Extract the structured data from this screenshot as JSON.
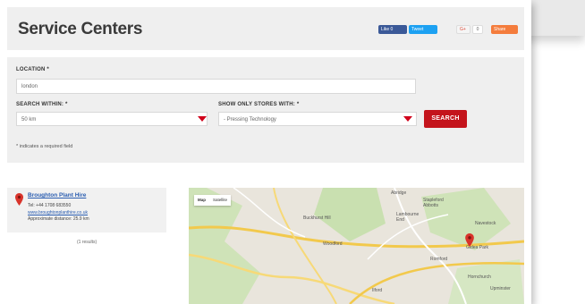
{
  "header": {
    "title": "Service Centers",
    "share": {
      "facebook": "Like 0",
      "twitter": "Tweet",
      "gplus": "G+",
      "gplus_count": "0",
      "share": "Share"
    }
  },
  "form": {
    "location_label": "LOCATION *",
    "location_value": "london",
    "within_label": "SEARCH WITHIN: *",
    "within_value": "50 km",
    "filter_label": "SHOW ONLY STORES WITH: *",
    "filter_value": "- Pressing Technology",
    "search_button": "SEARCH",
    "required_note": "* indicates a required field"
  },
  "results": {
    "name": "Broughton Plant Hire",
    "tel": "Tel: +44 1708 683550",
    "website": "www.broughtonplanthire.co.uk",
    "distance": "Approximate distance: 25.9 km",
    "count": "(1 results)"
  },
  "map": {
    "tabs": [
      "Map",
      "Satellite"
    ],
    "labels": [
      "Abridge",
      "Stapleford Abbotts",
      "Buckhurst Hill",
      "Lambourne End",
      "Navestock",
      "Woodford",
      "Romford",
      "Ilford",
      "Gidea Park",
      "Hornchurch",
      "Upminster"
    ]
  },
  "colors": {
    "accent": "#c4141c",
    "panel": "#efefef",
    "link": "#2a5db0"
  }
}
